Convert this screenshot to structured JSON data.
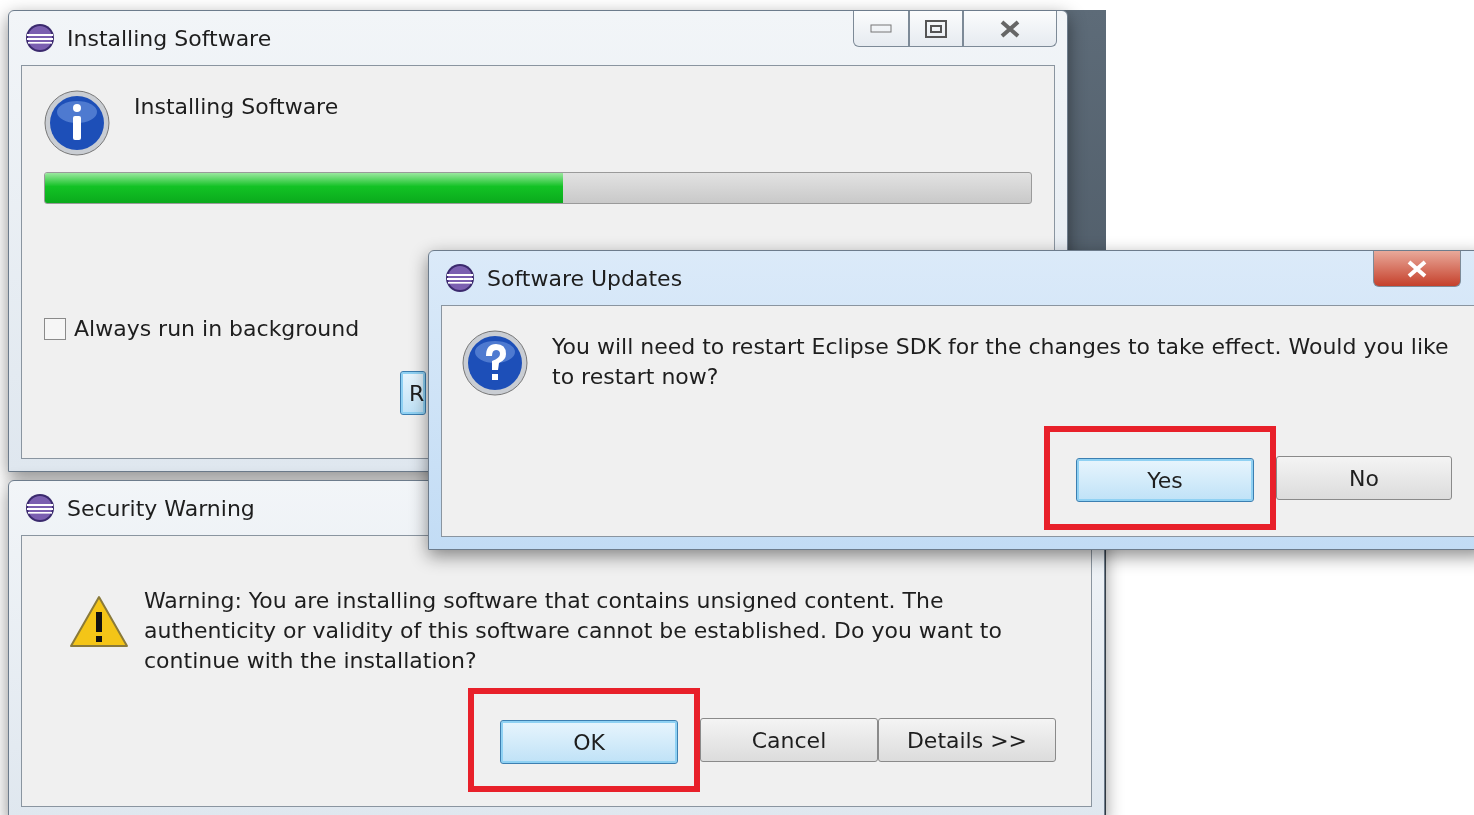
{
  "installing_window": {
    "title": "Installing Software",
    "heading": "Installing Software",
    "progress": {
      "level": 0.525
    },
    "checkbox": {
      "label": "Always run in background",
      "checked": false
    },
    "partial_button": "R"
  },
  "software_updates": {
    "title": "Software Updates",
    "message": "You will need to restart Eclipse SDK for the changes to take effect. Would you like to restart now?",
    "buttons": [
      {
        "label": "Yes",
        "default": true,
        "highlighted": true
      },
      {
        "label": "No",
        "default": false,
        "highlighted": false
      }
    ]
  },
  "security_warning": {
    "title": "Security Warning",
    "message": "Warning: You are installing software that contains unsigned content. The authenticity or validity of this software cannot be established. Do you want to continue with the installation?",
    "buttons": [
      {
        "label": "OK",
        "default": true,
        "highlighted": true
      },
      {
        "label": "Cancel",
        "default": false,
        "highlighted": false
      },
      {
        "label": "Details >>",
        "default": false,
        "highlighted": false
      }
    ]
  }
}
